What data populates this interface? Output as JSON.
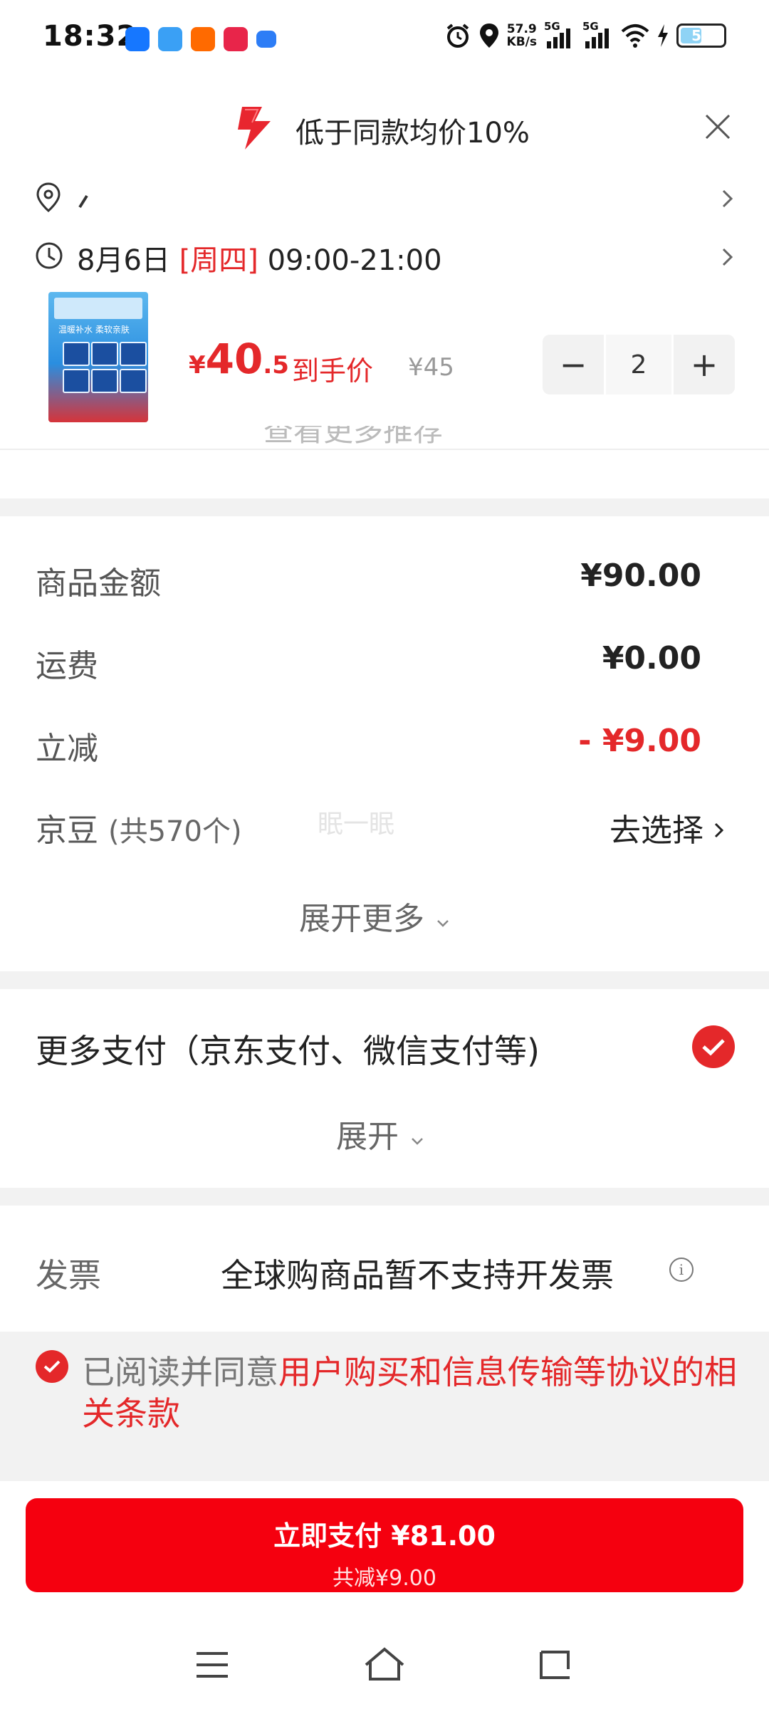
{
  "status_bar": {
    "time": "18:32",
    "net_speed_value": "57.9",
    "net_speed_unit": "KB/s",
    "signal_1": "5G",
    "signal_2": "5G",
    "battery": "50",
    "apps": [
      "alipay-icon",
      "feishu-icon",
      "taobao-icon",
      "xiaohongshu-icon",
      "message-icon"
    ],
    "app_colors": [
      "#1677ff",
      "#3aa0f5",
      "#ff6a00",
      "#e8254a",
      "#2d7df6"
    ]
  },
  "header": {
    "title": "低于同款均价10%",
    "icon": "lightning-icon",
    "accent": "#e4282a"
  },
  "delivery": {
    "date": "8月6日",
    "weekday": "[周四]",
    "time_range": "09:00-21:00"
  },
  "product": {
    "currency": "¥",
    "price_int": "40",
    "price_dec": ".5",
    "price_label": "到手价",
    "original_price": "¥45",
    "quantity": "2",
    "minus": "−",
    "plus": "+",
    "image_caption": "温暖补水 柔软亲肤"
  },
  "cut_hint": "查看更多推荐",
  "amounts": {
    "goods_label": "商品金额",
    "goods_value": "¥90.00",
    "shipping_label": "运费",
    "shipping_value": "¥0.00",
    "discount_label": "立减",
    "discount_value": "- ¥9.00",
    "beans_label": "京豆",
    "beans_count": "(共570个)",
    "beans_action": "去选择",
    "watermark": "眠一眠",
    "expand_more": "展开更多"
  },
  "payment": {
    "method": "更多支付（京东支付、微信支付等)",
    "expand": "展开"
  },
  "invoice": {
    "label": "发票",
    "value": "全球购商品暂不支持开发票"
  },
  "agreement": {
    "prefix": "已阅读并同意",
    "link": "用户购买和信息传输等协议的相关条款"
  },
  "pay_button": {
    "label": "立即支付 ¥81.00",
    "sub": "共减¥9.00",
    "color": "#f5000f"
  }
}
